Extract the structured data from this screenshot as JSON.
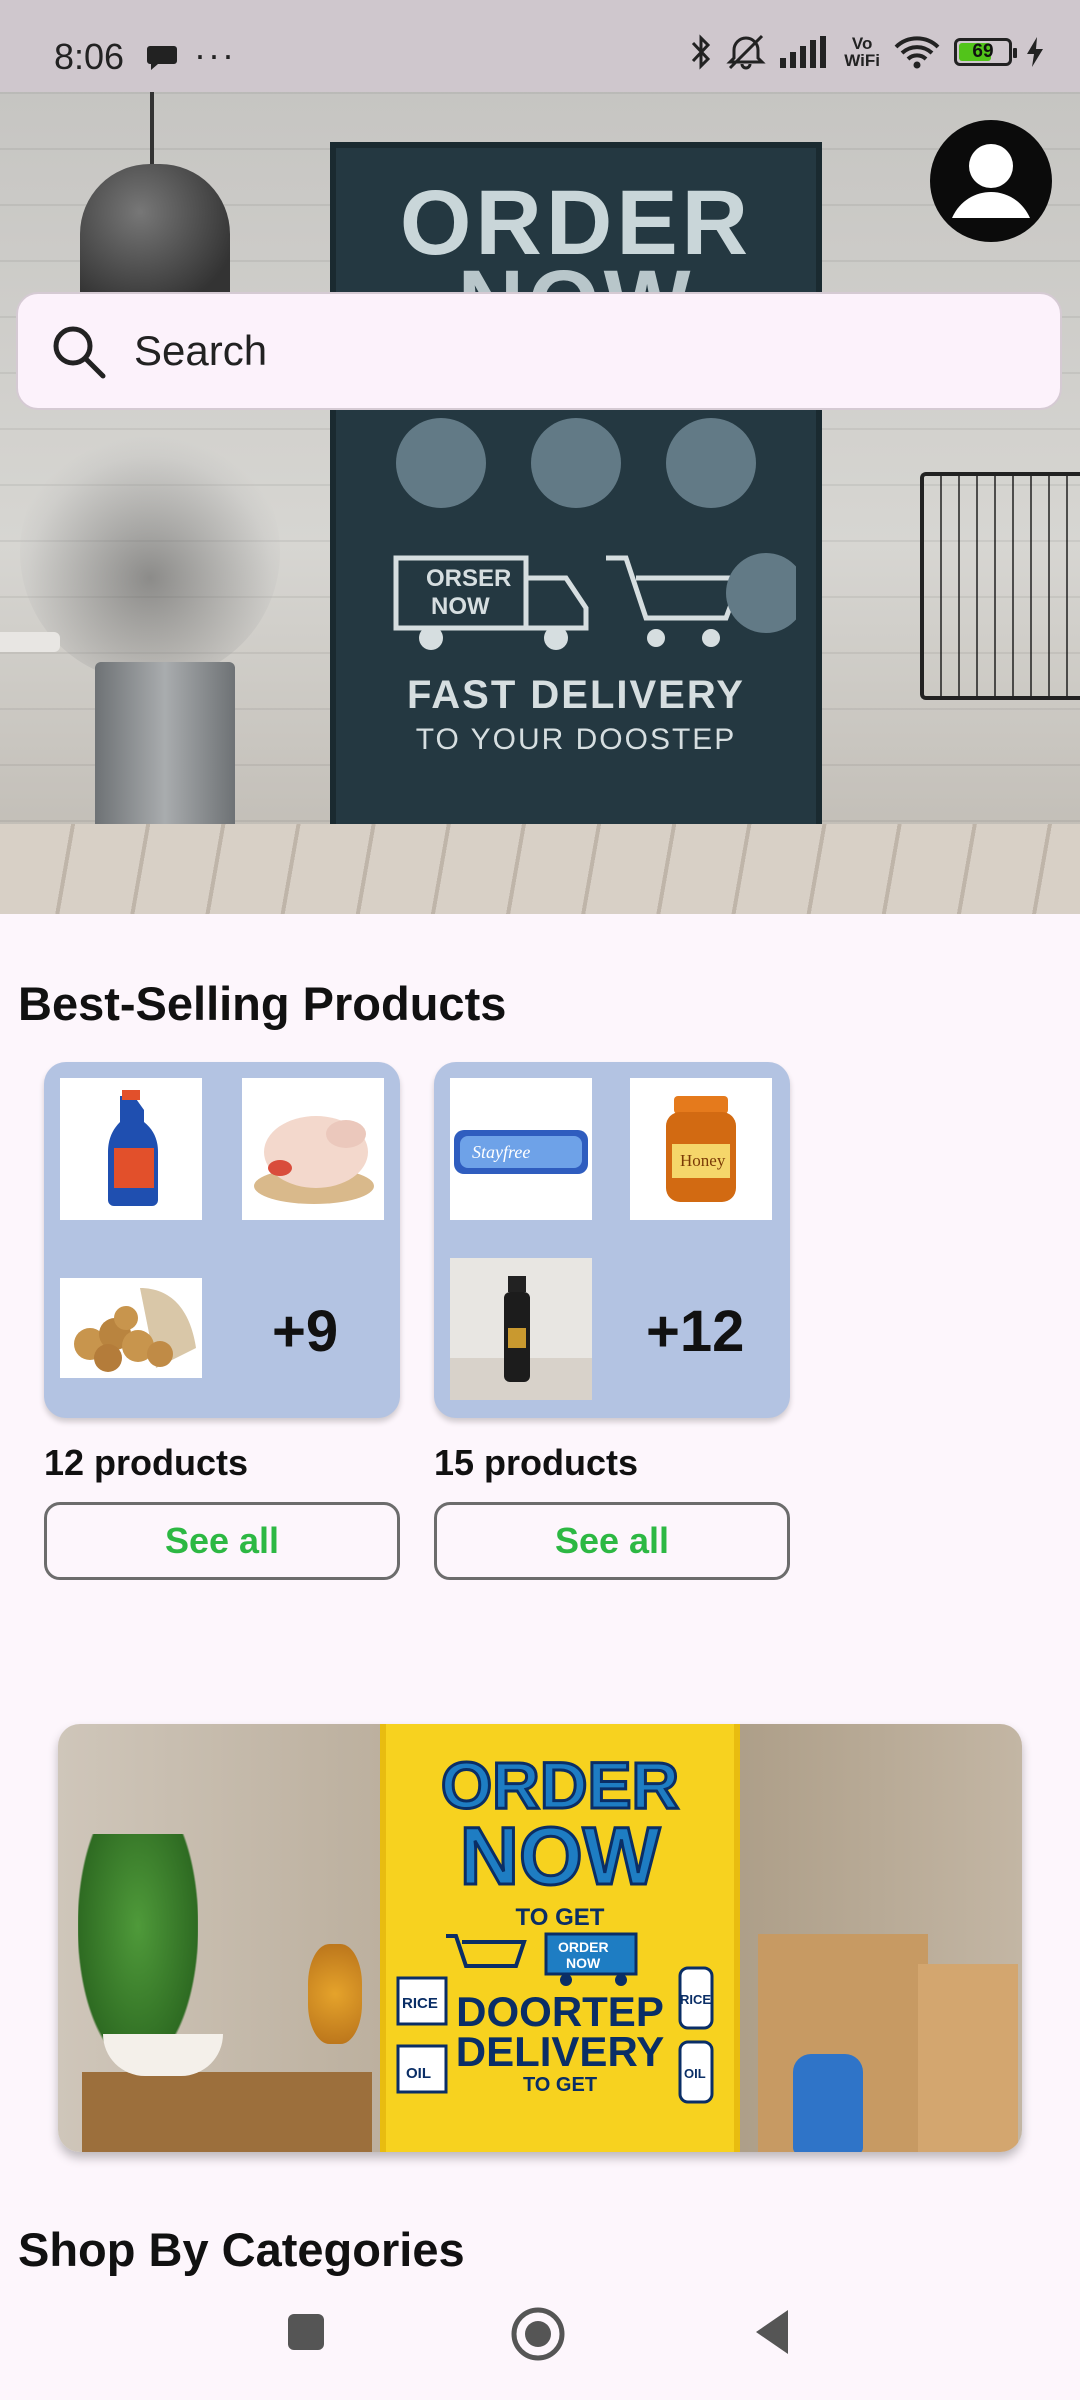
{
  "status_bar": {
    "time": "8:06",
    "vowifi_top": "Vo",
    "vowifi_bottom": "WiFi",
    "battery": "69",
    "icons": [
      "chat-bubble-icon",
      "more-dots-icon",
      "bluetooth-icon",
      "mute-icon",
      "signal-icon",
      "wifi-icon",
      "battery-icon",
      "charging-icon"
    ]
  },
  "hero": {
    "board_line1": "ORDER",
    "board_line2": "NOW",
    "board_truck_text_1": "ORSER",
    "board_truck_text_2": "NOW",
    "board_tagline1": "FAST DELIVERY",
    "board_tagline2": "TO YOUR DOOSTEP"
  },
  "search": {
    "placeholder": "Search"
  },
  "best_selling": {
    "title": "Best-Selling Products",
    "cards": [
      {
        "more": "+9",
        "count": "12 products",
        "button": "See all",
        "thumbs": [
          "toilet-cleaner",
          "chicken",
          "potatoes"
        ]
      },
      {
        "more": "+12",
        "count": "15 products",
        "button": "See all",
        "thumbs": [
          "sanitary-pads",
          "honey-jar",
          "sunscreen-spray"
        ]
      }
    ]
  },
  "banner": {
    "line1": "ORDER",
    "line2": "NOW",
    "line3": "TO GET",
    "line4a": "DOORTEP",
    "line4b": "DELIVERY",
    "line5": "TO GET",
    "truck_text_1": "ORDER",
    "truck_text_2": "NOW",
    "label_rice_1": "RICE",
    "label_rice_2": "RICE",
    "label_oil_1": "OIL",
    "label_oil_2": "OIL",
    "label_honey": "Honey"
  },
  "categories": {
    "title": "Shop By Categories"
  },
  "colors": {
    "background": "#FDF6FC",
    "card": "#B3C3E2",
    "see_all": "#2DB843",
    "status_bar": "#CFC7CD"
  }
}
